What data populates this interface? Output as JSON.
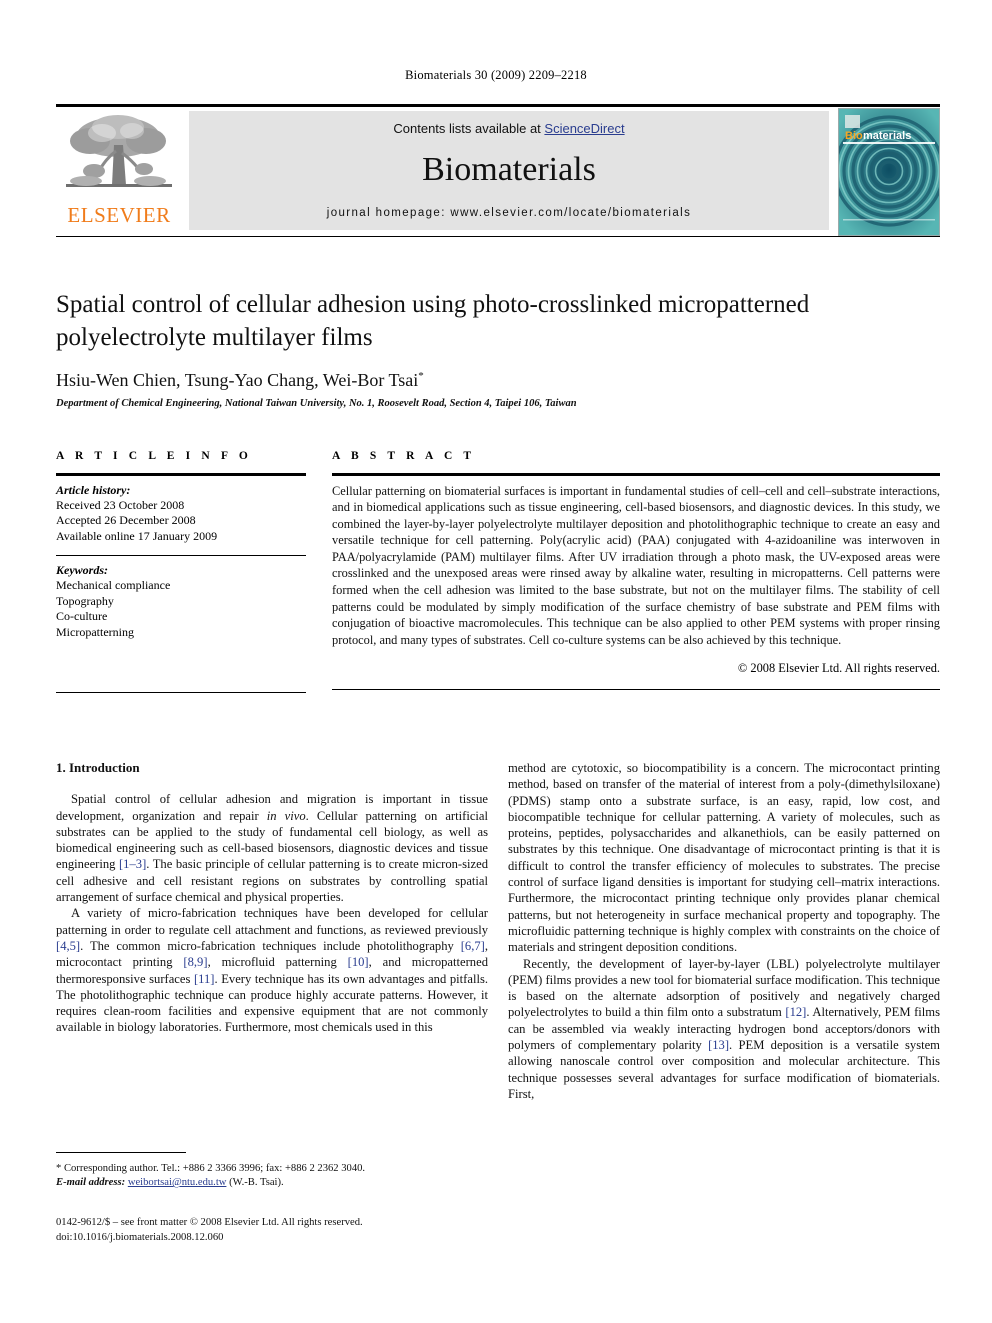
{
  "running_head": "Biomaterials 30 (2009) 2209–2218",
  "masthead": {
    "publisher_name": "ELSEVIER",
    "contents_prefix": "Contents lists available at ",
    "contents_link": "ScienceDirect",
    "journal_name": "Biomaterials",
    "homepage": "journal homepage: www.elsevier.com/locate/biomaterials",
    "cover_title_a": "Bio",
    "cover_title_b": "materials",
    "link_color": "#2a3d8f",
    "brand_color": "#f07c1b",
    "band_color": "#e3e3e3"
  },
  "article": {
    "title": "Spatial control of cellular adhesion using photo-crosslinked micropatterned polyelectrolyte multilayer films",
    "authors": "Hsiu-Wen Chien, Tsung-Yao Chang, Wei-Bor Tsai",
    "author_marker": "*",
    "affiliation": "Department of Chemical Engineering, National Taiwan University, No. 1, Roosevelt Road, Section 4, Taipei 106, Taiwan"
  },
  "article_info": {
    "heading": "A R T I C L E   I N F O",
    "history_label": "Article history:",
    "history": [
      "Received 23 October 2008",
      "Accepted 26 December 2008",
      "Available online 17 January 2009"
    ],
    "keywords_label": "Keywords:",
    "keywords": [
      "Mechanical compliance",
      "Topography",
      "Co-culture",
      "Micropatterning"
    ]
  },
  "abstract": {
    "heading": "A B S T R A C T",
    "text": "Cellular patterning on biomaterial surfaces is important in fundamental studies of cell–cell and cell–substrate interactions, and in biomedical applications such as tissue engineering, cell-based biosensors, and diagnostic devices. In this study, we combined the layer-by-layer polyelectrolyte multilayer deposition and photolithographic technique to create an easy and versatile technique for cell patterning. Poly(acrylic acid) (PAA) conjugated with 4-azidoaniline was interwoven in PAA/polyacrylamide (PAM) multilayer films. After UV irradiation through a photo mask, the UV-exposed areas were crosslinked and the unexposed areas were rinsed away by alkaline water, resulting in micropatterns. Cell patterns were formed when the cell adhesion was limited to the base substrate, but not on the multilayer films. The stability of cell patterns could be modulated by simply modification of the surface chemistry of base substrate and PEM films with conjugation of bioactive macromolecules. This technique can be also applied to other PEM systems with proper rinsing protocol, and many types of substrates. Cell co-culture systems can be also achieved by this technique.",
    "copyright": "© 2008 Elsevier Ltd. All rights reserved."
  },
  "body": {
    "section_heading": "1. Introduction",
    "left_paragraphs": [
      "Spatial control of cellular adhesion and migration is important in tissue development, organization and repair <i>in vivo</i>. Cellular patterning on artificial substrates can be applied to the study of fundamental cell biology, as well as biomedical engineering such as cell-based biosensors, diagnostic devices and tissue engineering <span class=\"ref\">[1–3]</span>. The basic principle of cellular patterning is to create micron-sized cell adhesive and cell resistant regions on substrates by controlling spatial arrangement of surface chemical and physical properties.",
      "A variety of micro-fabrication techniques have been developed for cellular patterning in order to regulate cell attachment and functions, as reviewed previously <span class=\"ref\">[4,5]</span>. The common micro-fabrication techniques include photolithography <span class=\"ref\">[6,7]</span>, microcontact printing <span class=\"ref\">[8,9]</span>, microfluid patterning <span class=\"ref\">[10]</span>, and micropatterned thermoresponsive surfaces <span class=\"ref\">[11]</span>. Every technique has its own advantages and pitfalls. The photolithographic technique can produce highly accurate patterns. However, it requires clean-room facilities and expensive equipment that are not commonly available in biology laboratories. Furthermore, most chemicals used in this"
    ],
    "right_paragraphs": [
      "method are cytotoxic, so biocompatibility is a concern. The microcontact printing method, based on transfer of the material of interest from a poly-(dimethylsiloxane) (PDMS) stamp onto a substrate surface, is an easy, rapid, low cost, and biocompatible technique for cellular patterning. A variety of molecules, such as proteins, peptides, polysaccharides and alkanethiols, can be easily patterned on substrates by this technique. One disadvantage of microcontact printing is that it is difficult to control the transfer efficiency of molecules to substrates. The precise control of surface ligand densities is important for studying cell–matrix interactions. Furthermore, the microcontact printing technique only provides planar chemical patterns, but not heterogeneity in surface mechanical property and topography. The microfluidic patterning technique is highly complex with constraints on the choice of materials and stringent deposition conditions.",
      "Recently, the development of layer-by-layer (LBL) polyelectrolyte multilayer (PEM) films provides a new tool for biomaterial surface modification. This technique is based on the alternate adsorption of positively and negatively charged polyelectrolytes to build a thin film onto a substratum <span class=\"ref\">[12]</span>. Alternatively, PEM films can be assembled via weakly interacting hydrogen bond acceptors/donors with polymers of complementary polarity <span class=\"ref\">[13]</span>. PEM deposition is a versatile system allowing nanoscale control over composition and molecular architecture. This technique possesses several advantages for surface modification of biomaterials. First,"
    ]
  },
  "footnote": {
    "line1": "* Corresponding author. Tel.: +886 2 3366 3996; fax: +886 2 2362 3040.",
    "email_label": "E-mail address:",
    "email": "weibortsai@ntu.edu.tw",
    "email_suffix": "(W.-B. Tsai)."
  },
  "footer": {
    "line1": "0142-9612/$ – see front matter © 2008 Elsevier Ltd. All rights reserved.",
    "line2": "doi:10.1016/j.biomaterials.2008.12.060"
  }
}
